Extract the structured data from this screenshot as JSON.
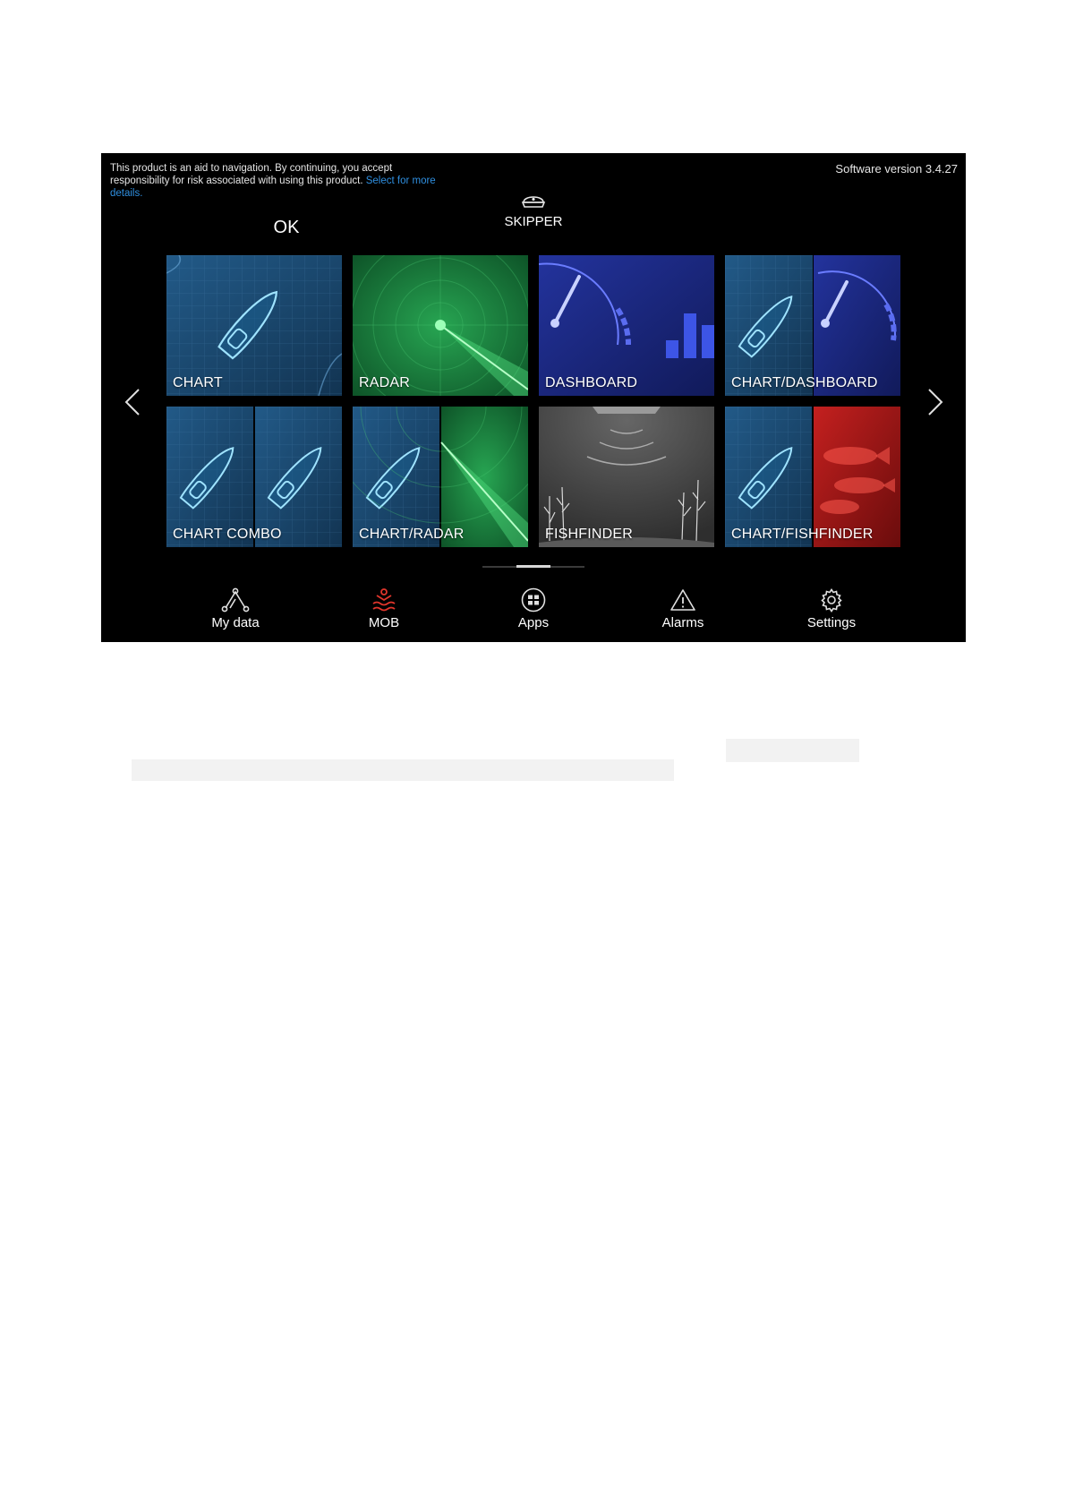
{
  "header": {
    "disclaimer_text": "This product is an aid to navigation. By continuing, you accept responsibility for risk associated with using this product.",
    "disclaimer_link": "Select for more details.",
    "software_version": "Software version 3.4.27",
    "ok_label": "OK",
    "profile_label": "SKIPPER"
  },
  "apps": [
    {
      "label": "CHART",
      "icon": "chart-tile-icon"
    },
    {
      "label": "RADAR",
      "icon": "radar-tile-icon"
    },
    {
      "label": "DASHBOARD",
      "icon": "dashboard-tile-icon"
    },
    {
      "label": "CHART/DASHBOARD",
      "icon": "chart-dashboard-tile-icon"
    },
    {
      "label": "CHART COMBO",
      "icon": "chart-combo-tile-icon"
    },
    {
      "label": "CHART/RADAR",
      "icon": "chart-radar-tile-icon"
    },
    {
      "label": "FISHFINDER",
      "icon": "fishfinder-tile-icon"
    },
    {
      "label": "CHART/FISHFINDER",
      "icon": "chart-fishfinder-tile-icon"
    }
  ],
  "pager": {
    "current_page": 2,
    "total_pages": 3
  },
  "nav": [
    {
      "label": "My data",
      "icon": "waypoint-route-icon"
    },
    {
      "label": "MOB",
      "icon": "man-overboard-icon"
    },
    {
      "label": "Apps",
      "icon": "apps-grid-icon"
    },
    {
      "label": "Alarms",
      "icon": "warning-triangle-icon"
    },
    {
      "label": "Settings",
      "icon": "gear-icon"
    }
  ],
  "colors": {
    "screen_bg": "#000000",
    "link": "#2f8fe0",
    "mob_red": "#e0352b",
    "chart_blue": "#1d4f7a",
    "radar_green": "#1f8a45",
    "dashboard_blue": "#1d2a8a",
    "fishfinder_gray": "#444444",
    "fish_red": "#b01818"
  }
}
